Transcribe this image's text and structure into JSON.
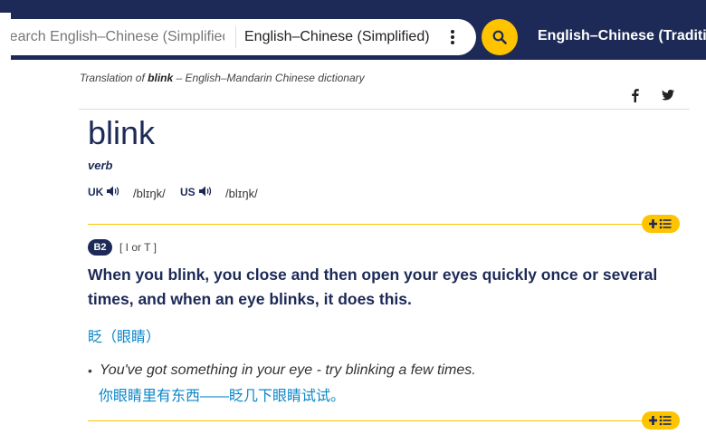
{
  "header": {
    "search_placeholder": "Search English–Chinese (Simplified)",
    "dictionary_selected": "English–Chinese (Simplified)",
    "other_dictionary": "English–Chinese (Traditional)"
  },
  "breadcrumb": {
    "prefix": "Translation of",
    "word": "blink",
    "suffix": "– English–Mandarin Chinese dictionary"
  },
  "entry": {
    "headword": "blink",
    "pos": "verb",
    "uk_label": "UK",
    "uk_ipa": "/blɪŋk/",
    "us_label": "US",
    "us_ipa": "/blɪŋk/"
  },
  "sense": {
    "level": "B2",
    "grammar": "[ I or T ]",
    "definition": "When you blink, you close and then open your eyes quickly once or several times, and when an eye blinks, it does this.",
    "translation": "眨（眼睛）",
    "example": "You've got something in your eye - try blinking a few times.",
    "example_translation": "你眼睛里有东西——眨几下眼睛试试。"
  },
  "colors": {
    "navy": "#1d2a57",
    "accent_yellow": "#fec400",
    "translation_blue": "#0a86c9"
  }
}
